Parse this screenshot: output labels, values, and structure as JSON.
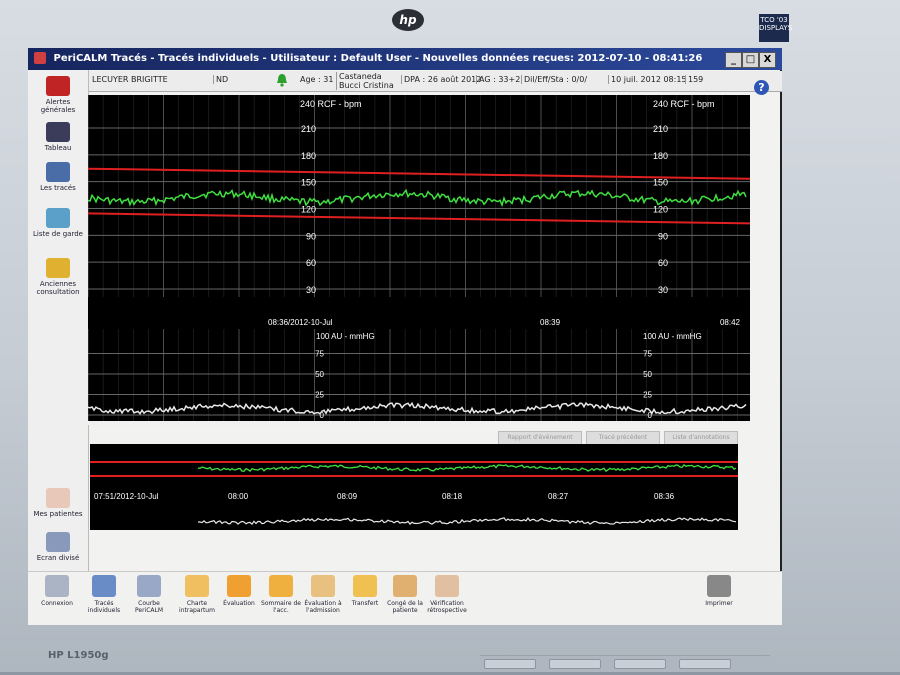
{
  "monitor": {
    "brand": "hp",
    "model": "HP L1950g",
    "badge": "TCO '03 DISPLAYS"
  },
  "app": {
    "title": "PeriCALM Tracés - Tracés individuels - Utilisateur : Default User - Nouvelles données reçues: 2012-07-10 - 08:41:26",
    "window_buttons": [
      "_",
      "□",
      "X"
    ]
  },
  "patient": {
    "name": "LECUYER BRIGITTE",
    "id": "ND",
    "age": "Age : 31",
    "physician": "Castaneda Bucci Cristina",
    "dpa": "DPA : 26 août 2012",
    "ag": "AG : 33+2",
    "dil": "Dil/Eff/Sta : 0/0/",
    "datetime": "10 juil. 2012 08:15",
    "room": "159"
  },
  "sidebar": {
    "items": [
      {
        "label": "Alertes générales",
        "icon": "bell-icon"
      },
      {
        "label": "Tableau",
        "icon": "table-icon"
      },
      {
        "label": "Les tracés",
        "icon": "traces-icon"
      },
      {
        "label": "Liste de garde",
        "icon": "staff-list-icon"
      },
      {
        "label": "Anciennes consultation",
        "icon": "folder-icon"
      },
      {
        "label": "Mes patientes",
        "icon": "patients-icon"
      },
      {
        "label": "Ecran divisé",
        "icon": "split-screen-icon"
      }
    ]
  },
  "fhr_chart": {
    "title_left": "240 RCF - bpm",
    "title_right": "240 RCF - bpm",
    "ticks": [
      "210",
      "180",
      "150",
      "120",
      "90",
      "60",
      "30"
    ],
    "limit_upper": 160,
    "limit_lower": 110,
    "colors": {
      "trace": "#3fe03f",
      "limit": "#e02020",
      "grid": "#666666",
      "background": "#000000"
    }
  },
  "toco_chart": {
    "title_left": "100 AU - mmHG",
    "title_right": "100 AU - mmHG",
    "ticks": [
      "75",
      "50",
      "25",
      "0"
    ],
    "time_labels": [
      "08:36/2012-10-Jul",
      "08:39",
      "08:42"
    ],
    "colors": {
      "trace": "#e8e8e8"
    }
  },
  "chart_buttons": [
    "Rapport d'événement",
    "Tracé précédent",
    "Liste d'annotations"
  ],
  "overview": {
    "time_labels": [
      "07:51/2012-10-Jul",
      "08:00",
      "08:09",
      "08:18",
      "08:27",
      "08:36"
    ]
  },
  "toolbar": {
    "items": [
      {
        "label": "Connexion",
        "icon": "fingerprint-icon"
      },
      {
        "label": "Tracés individuels",
        "icon": "waveform-icon"
      },
      {
        "label": "Courbe PeriCALM",
        "icon": "curve-icon"
      },
      {
        "label": "Charte intrapartum",
        "icon": "chart-doc-icon"
      },
      {
        "label": "Évaluation",
        "icon": "evaluation-icon"
      },
      {
        "label": "Sommaire de l'acc.",
        "icon": "summary-icon"
      },
      {
        "label": "Évaluation à l'admission",
        "icon": "admission-icon"
      },
      {
        "label": "Transfert",
        "icon": "transfer-icon"
      },
      {
        "label": "Congé de la patiente",
        "icon": "discharge-icon"
      },
      {
        "label": "Vérification rétrospective",
        "icon": "retro-check-icon"
      },
      {
        "label": "Imprimer",
        "icon": "printer-icon"
      }
    ]
  }
}
